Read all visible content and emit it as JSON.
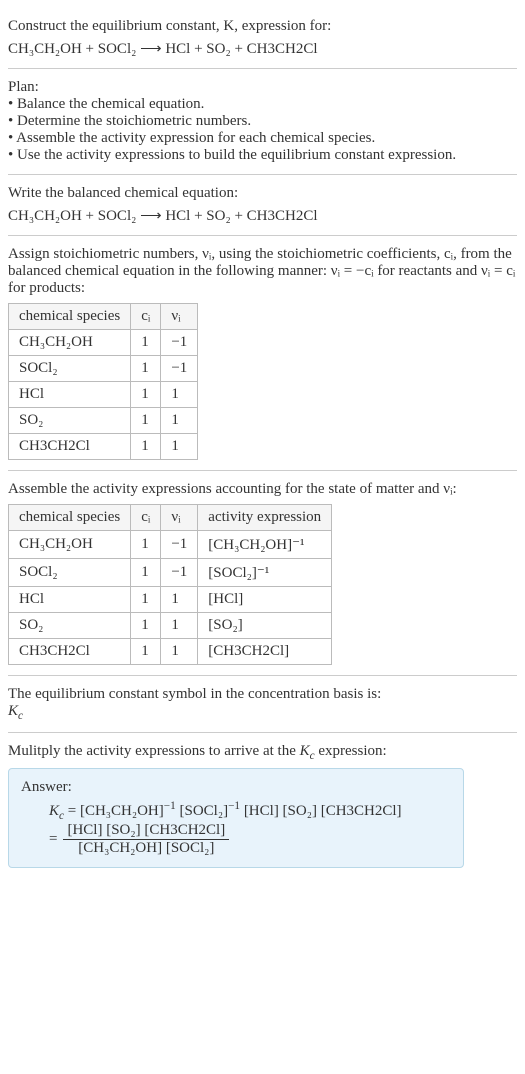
{
  "title": {
    "line1": "Construct the equilibrium constant, K, expression for:",
    "equation": "CH₃CH₂OH + SOCl₂ ⟶ HCl + SO₂ + CH3CH2Cl"
  },
  "plan": {
    "heading": "Plan:",
    "items": [
      "• Balance the chemical equation.",
      "• Determine the stoichiometric numbers.",
      "• Assemble the activity expression for each chemical species.",
      "• Use the activity expressions to build the equilibrium constant expression."
    ]
  },
  "balanced": {
    "heading": "Write the balanced chemical equation:",
    "equation": "CH₃CH₂OH + SOCl₂ ⟶ HCl + SO₂ + CH3CH2Cl"
  },
  "stoich": {
    "heading": "Assign stoichiometric numbers, νᵢ, using the stoichiometric coefficients, cᵢ, from the balanced chemical equation in the following manner: νᵢ = −cᵢ for reactants and νᵢ = cᵢ for products:",
    "headers": {
      "species": "chemical species",
      "ci": "cᵢ",
      "vi": "νᵢ"
    },
    "rows": [
      {
        "species": "CH₃CH₂OH",
        "ci": "1",
        "vi": "−1"
      },
      {
        "species": "SOCl₂",
        "ci": "1",
        "vi": "−1"
      },
      {
        "species": "HCl",
        "ci": "1",
        "vi": "1"
      },
      {
        "species": "SO₂",
        "ci": "1",
        "vi": "1"
      },
      {
        "species": "CH3CH2Cl",
        "ci": "1",
        "vi": "1"
      }
    ]
  },
  "activity": {
    "heading": "Assemble the activity expressions accounting for the state of matter and νᵢ:",
    "headers": {
      "species": "chemical species",
      "ci": "cᵢ",
      "vi": "νᵢ",
      "act": "activity expression"
    },
    "rows": [
      {
        "species": "CH₃CH₂OH",
        "ci": "1",
        "vi": "−1",
        "act": "[CH₃CH₂OH]⁻¹"
      },
      {
        "species": "SOCl₂",
        "ci": "1",
        "vi": "−1",
        "act": "[SOCl₂]⁻¹"
      },
      {
        "species": "HCl",
        "ci": "1",
        "vi": "1",
        "act": "[HCl]"
      },
      {
        "species": "SO₂",
        "ci": "1",
        "vi": "1",
        "act": "[SO₂]"
      },
      {
        "species": "CH3CH2Cl",
        "ci": "1",
        "vi": "1",
        "act": "[CH3CH2Cl]"
      }
    ]
  },
  "symbol": {
    "line1": "The equilibrium constant symbol in the concentration basis is:",
    "line2": "K_c"
  },
  "multiply": {
    "heading": "Mulitply the activity expressions to arrive at the K_c expression:"
  },
  "answer": {
    "label": "Answer:",
    "line1": "K_c = [CH₃CH₂OH]⁻¹ [SOCl₂]⁻¹ [HCl] [SO₂] [CH3CH2Cl]",
    "frac_num": "[HCl] [SO₂] [CH3CH2Cl]",
    "frac_den": "[CH₃CH₂OH] [SOCl₂]",
    "eq_prefix": "= "
  }
}
